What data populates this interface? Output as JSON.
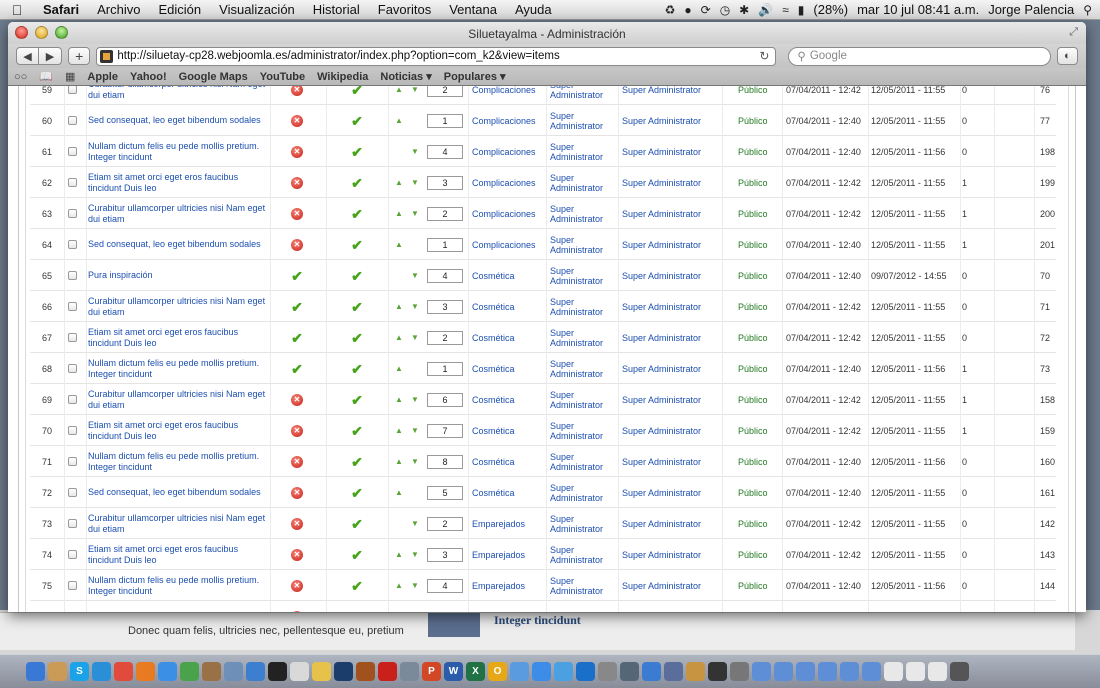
{
  "menubar": {
    "app": "Safari",
    "items": [
      "Archivo",
      "Edición",
      "Visualización",
      "Historial",
      "Favoritos",
      "Ventana",
      "Ayuda"
    ],
    "battery": "(28%)",
    "datetime": "mar 10 jul  08:41 a.m.",
    "user": "Jorge Palencia"
  },
  "window": {
    "title": "Siluetayalma - Administración",
    "url": "http://siluetay-cp28.webjoomla.es/administrator/index.php?option=com_k2&view=items",
    "search_placeholder": "Google",
    "bookmarks": [
      "Apple",
      "Yahoo!",
      "Google Maps",
      "YouTube",
      "Wikipedia",
      "Noticias ▾",
      "Populares ▾"
    ]
  },
  "table": {
    "rows": [
      {
        "num": "59",
        "title": "Curabitur ullamcorper ultricies nisi Nam eget dui etiam",
        "published": false,
        "featured": true,
        "up": true,
        "down": true,
        "order": "2",
        "category": "Complicaciones",
        "author": "Super Administrator",
        "modified_by": "Super Administrator",
        "access": "Público",
        "created": "07/04/2011 - 12:42",
        "modified": "12/05/2011 - 11:55",
        "hits": "0",
        "id": "76"
      },
      {
        "num": "60",
        "title": "Sed consequat, leo eget bibendum sodales",
        "published": false,
        "featured": true,
        "up": true,
        "down": false,
        "order": "1",
        "category": "Complicaciones",
        "author": "Super Administrator",
        "modified_by": "Super Administrator",
        "access": "Público",
        "created": "07/04/2011 - 12:40",
        "modified": "12/05/2011 - 11:55",
        "hits": "0",
        "id": "77"
      },
      {
        "num": "61",
        "title": "Nullam dictum felis eu pede mollis pretium. Integer tincidunt",
        "published": false,
        "featured": true,
        "up": false,
        "down": true,
        "order": "4",
        "category": "Complicaciones",
        "author": "Super Administrator",
        "modified_by": "Super Administrator",
        "access": "Público",
        "created": "07/04/2011 - 12:40",
        "modified": "12/05/2011 - 11:56",
        "hits": "0",
        "id": "198"
      },
      {
        "num": "62",
        "title": "Etiam sit amet orci eget eros faucibus tincidunt Duis leo",
        "published": false,
        "featured": true,
        "up": true,
        "down": true,
        "order": "3",
        "category": "Complicaciones",
        "author": "Super Administrator",
        "modified_by": "Super Administrator",
        "access": "Público",
        "created": "07/04/2011 - 12:42",
        "modified": "12/05/2011 - 11:55",
        "hits": "1",
        "id": "199"
      },
      {
        "num": "63",
        "title": "Curabitur ullamcorper ultricies nisi Nam eget dui etiam",
        "published": false,
        "featured": true,
        "up": true,
        "down": true,
        "order": "2",
        "category": "Complicaciones",
        "author": "Super Administrator",
        "modified_by": "Super Administrator",
        "access": "Público",
        "created": "07/04/2011 - 12:42",
        "modified": "12/05/2011 - 11:55",
        "hits": "1",
        "id": "200"
      },
      {
        "num": "64",
        "title": "Sed consequat, leo eget bibendum sodales",
        "published": false,
        "featured": true,
        "up": true,
        "down": false,
        "order": "1",
        "category": "Complicaciones",
        "author": "Super Administrator",
        "modified_by": "Super Administrator",
        "access": "Público",
        "created": "07/04/2011 - 12:40",
        "modified": "12/05/2011 - 11:55",
        "hits": "1",
        "id": "201"
      },
      {
        "num": "65",
        "title": "Pura inspiración",
        "published": true,
        "featured": true,
        "up": false,
        "down": true,
        "order": "4",
        "category": "Cosmética",
        "author": "Super Administrator",
        "modified_by": "Super Administrator",
        "access": "Público",
        "created": "07/04/2011 - 12:40",
        "modified": "09/07/2012 - 14:55",
        "hits": "0",
        "id": "70"
      },
      {
        "num": "66",
        "title": "Curabitur ullamcorper ultricies nisi Nam eget dui etiam",
        "published": true,
        "featured": true,
        "up": true,
        "down": true,
        "order": "3",
        "category": "Cosmética",
        "author": "Super Administrator",
        "modified_by": "Super Administrator",
        "access": "Público",
        "created": "07/04/2011 - 12:42",
        "modified": "12/05/2011 - 11:55",
        "hits": "0",
        "id": "71"
      },
      {
        "num": "67",
        "title": "Etiam sit amet orci eget eros faucibus tincidunt Duis leo",
        "published": true,
        "featured": true,
        "up": true,
        "down": true,
        "order": "2",
        "category": "Cosmética",
        "author": "Super Administrator",
        "modified_by": "Super Administrator",
        "access": "Público",
        "created": "07/04/2011 - 12:42",
        "modified": "12/05/2011 - 11:55",
        "hits": "0",
        "id": "72"
      },
      {
        "num": "68",
        "title": "Nullam dictum felis eu pede mollis pretium. Integer tincidunt",
        "published": true,
        "featured": true,
        "up": true,
        "down": false,
        "order": "1",
        "category": "Cosmética",
        "author": "Super Administrator",
        "modified_by": "Super Administrator",
        "access": "Público",
        "created": "07/04/2011 - 12:40",
        "modified": "12/05/2011 - 11:56",
        "hits": "1",
        "id": "73"
      },
      {
        "num": "69",
        "title": "Curabitur ullamcorper ultricies nisi Nam eget dui etiam",
        "published": false,
        "featured": true,
        "up": true,
        "down": true,
        "order": "6",
        "category": "Cosmética",
        "author": "Super Administrator",
        "modified_by": "Super Administrator",
        "access": "Público",
        "created": "07/04/2011 - 12:42",
        "modified": "12/05/2011 - 11:55",
        "hits": "1",
        "id": "158"
      },
      {
        "num": "70",
        "title": "Etiam sit amet orci eget eros faucibus tincidunt Duis leo",
        "published": false,
        "featured": true,
        "up": true,
        "down": true,
        "order": "7",
        "category": "Cosmética",
        "author": "Super Administrator",
        "modified_by": "Super Administrator",
        "access": "Público",
        "created": "07/04/2011 - 12:42",
        "modified": "12/05/2011 - 11:55",
        "hits": "1",
        "id": "159"
      },
      {
        "num": "71",
        "title": "Nullam dictum felis eu pede mollis pretium. Integer tincidunt",
        "published": false,
        "featured": true,
        "up": true,
        "down": true,
        "order": "8",
        "category": "Cosmética",
        "author": "Super Administrator",
        "modified_by": "Super Administrator",
        "access": "Público",
        "created": "07/04/2011 - 12:40",
        "modified": "12/05/2011 - 11:56",
        "hits": "0",
        "id": "160"
      },
      {
        "num": "72",
        "title": "Sed consequat, leo eget bibendum sodales",
        "published": false,
        "featured": true,
        "up": true,
        "down": false,
        "order": "5",
        "category": "Cosmética",
        "author": "Super Administrator",
        "modified_by": "Super Administrator",
        "access": "Público",
        "created": "07/04/2011 - 12:40",
        "modified": "12/05/2011 - 11:55",
        "hits": "0",
        "id": "161"
      },
      {
        "num": "73",
        "title": "Curabitur ullamcorper ultricies nisi Nam eget dui etiam",
        "published": false,
        "featured": true,
        "up": false,
        "down": true,
        "order": "2",
        "category": "Emparejados",
        "author": "Super Administrator",
        "modified_by": "Super Administrator",
        "access": "Público",
        "created": "07/04/2011 - 12:42",
        "modified": "12/05/2011 - 11:55",
        "hits": "0",
        "id": "142"
      },
      {
        "num": "74",
        "title": "Etiam sit amet orci eget eros faucibus tincidunt Duis leo",
        "published": false,
        "featured": true,
        "up": true,
        "down": true,
        "order": "3",
        "category": "Emparejados",
        "author": "Super Administrator",
        "modified_by": "Super Administrator",
        "access": "Público",
        "created": "07/04/2011 - 12:42",
        "modified": "12/05/2011 - 11:55",
        "hits": "0",
        "id": "143"
      },
      {
        "num": "75",
        "title": "Nullam dictum felis eu pede mollis pretium. Integer tincidunt",
        "published": false,
        "featured": true,
        "up": true,
        "down": true,
        "order": "4",
        "category": "Emparejados",
        "author": "Super Administrator",
        "modified_by": "Super Administrator",
        "access": "Público",
        "created": "07/04/2011 - 12:40",
        "modified": "12/05/2011 - 11:56",
        "hits": "0",
        "id": "144"
      },
      {
        "num": "",
        "title": "Sed consequat, leo eget bibendum",
        "published": false,
        "featured": true,
        "up": false,
        "down": false,
        "order": "",
        "category": "",
        "author": "Super",
        "modified_by": "",
        "access": "",
        "created": "",
        "modified": "",
        "hits": "",
        "id": ""
      }
    ]
  },
  "background_window": {
    "snippet_left": "Donec quam felis, ultricies nec, pellentesque eu, pretium",
    "snippet_heading": "Integer tincidunt"
  },
  "colors": {
    "link": "#1c4fb0",
    "access_green": "#237a23",
    "unpublished_red": "#c81e14",
    "check_green": "#47a31a"
  }
}
